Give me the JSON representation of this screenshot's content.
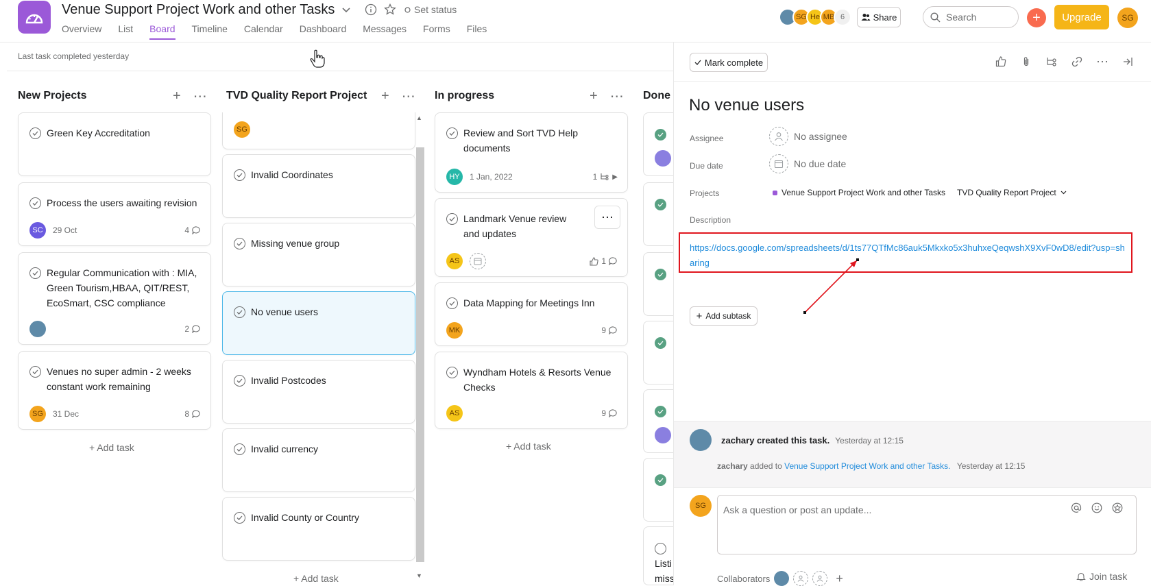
{
  "header": {
    "project_title": "Venue Support Project Work and other Tasks",
    "set_status": "Set status",
    "tabs": [
      "Overview",
      "List",
      "Board",
      "Timeline",
      "Calendar",
      "Dashboard",
      "Messages",
      "Forms",
      "Files"
    ],
    "active_tab": "Board",
    "members": [
      {
        "initials": "",
        "color": "#5e8aa8"
      },
      {
        "initials": "SG",
        "color": "#f3a41d"
      },
      {
        "initials": "He",
        "color": "#f5c518"
      },
      {
        "initials": "MB",
        "color": "#f3a41d"
      }
    ],
    "member_count": "6",
    "share_label": "Share",
    "search_placeholder": "Search",
    "upgrade_label": "Upgrade",
    "me_initials": "SG"
  },
  "subheader": {
    "last_completed": "Last task completed yesterday"
  },
  "board": {
    "columns": [
      {
        "title": "New Projects",
        "cards": [
          {
            "title": "Green Key Accreditation"
          },
          {
            "title": "Process the users awaiting revision",
            "avatar": "SC",
            "avatar_color": "#6a5ae0",
            "date": "29 Oct",
            "comments": "4"
          },
          {
            "title": "Regular Communication with : MIA, Green Tourism,HBAA, QIT/REST, EcoSmart, CSC compliance",
            "avatar": "",
            "avatar_color": "#5e8aa8",
            "comments": "2"
          },
          {
            "title": "Venues no super admin - 2 weeks constant work remaining",
            "avatar": "SG",
            "avatar_color": "#f3a41d",
            "date": "31 Dec",
            "comments": "8"
          }
        ],
        "add_task": "+ Add task"
      },
      {
        "title": "TVD Quality Report Project",
        "cards": [
          {
            "title": "",
            "avatar": "SG",
            "avatar_color": "#f3a41d"
          },
          {
            "title": "Invalid Coordinates"
          },
          {
            "title": "Missing venue group"
          },
          {
            "title": "No venue users",
            "selected": true
          },
          {
            "title": "Invalid Postcodes"
          },
          {
            "title": "Invalid currency"
          },
          {
            "title": "Invalid County or Country"
          }
        ],
        "add_task": "+ Add task"
      },
      {
        "title": "In progress",
        "cards": [
          {
            "title": "Review and Sort TVD Help documents",
            "avatar": "HY",
            "avatar_color": "#25b7a8",
            "date": "1 Jan, 2022",
            "subtasks": "1"
          },
          {
            "title": "Landmark Venue review and updates",
            "avatar": "AS",
            "avatar_color": "#f5c518",
            "likes": "1"
          },
          {
            "title": "Data Mapping for Meetings Inn",
            "avatar": "MK",
            "avatar_color": "#f3a41d",
            "comments": "9"
          },
          {
            "title": "Wyndham Hotels & Resorts Venue Checks",
            "avatar": "AS",
            "avatar_color": "#f5c518",
            "comments": "9"
          }
        ],
        "add_task": "+ Add task"
      },
      {
        "title": "Done",
        "cards": [],
        "partial_text": [
          "Listi",
          "miss"
        ]
      }
    ]
  },
  "detail": {
    "mark_complete": "Mark complete",
    "task_name": "No venue users",
    "assignee_label": "Assignee",
    "assignee_value": "No assignee",
    "due_label": "Due date",
    "due_value": "No due date",
    "projects_label": "Projects",
    "project_1": "Venue Support Project Work and other Tasks",
    "project_2": "TVD Quality Report Project",
    "description_label": "Description",
    "description_link": "https://docs.google.com/spreadsheets/d/1ts77QTfMc86auk5Mkxko5x3huhxeQeqwshX9XvF0wD8/edit?usp=sharing",
    "add_subtask": "Add subtask",
    "activity": {
      "creator": "zachary created this task.",
      "created_time": "Yesterday at 12:15",
      "adder": "zachary",
      "added_to": "added to",
      "project_link": "Venue Support Project Work and other Tasks.",
      "added_time": "Yesterday at 12:15"
    },
    "comment_placeholder": "Ask a question or post an update...",
    "commenter_initials": "SG",
    "collaborators_label": "Collaborators",
    "join_task": "Join task"
  },
  "colors": {
    "brand": "#9b59d8",
    "upgrade": "#f5b517",
    "plus": "#f96b4f",
    "highlight_box": "#e0151d",
    "link": "#1f8bdb"
  }
}
